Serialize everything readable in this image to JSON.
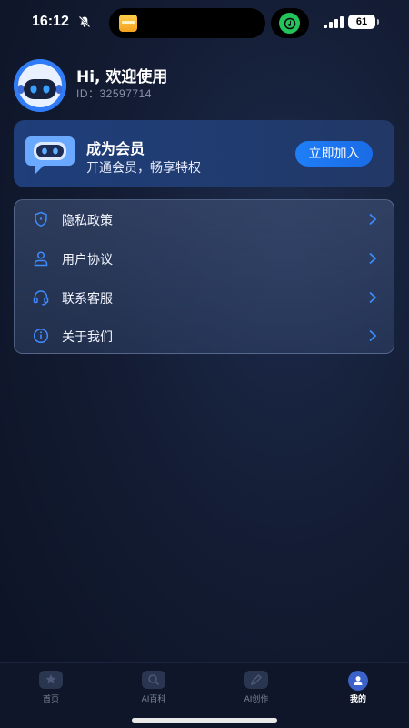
{
  "status_bar": {
    "time": "16:12",
    "battery": "61",
    "icons": [
      "bell-slash-icon",
      "app-activity-icon",
      "music-icon",
      "signal-icon",
      "battery-icon"
    ]
  },
  "profile": {
    "greeting": "Hi, 欢迎使用",
    "id_text": "ID：32597714",
    "avatar_icon": "robot-avatar-icon"
  },
  "member_card": {
    "title": "成为会员",
    "subtitle": "开通会员，畅享特权",
    "button_label": "立即加入",
    "icon": "robot-chat-icon"
  },
  "menu": {
    "items": [
      {
        "label": "隐私政策",
        "icon": "shield-icon"
      },
      {
        "label": "用户协议",
        "icon": "user-icon"
      },
      {
        "label": "联系客服",
        "icon": "headset-icon"
      },
      {
        "label": "关于我们",
        "icon": "info-icon"
      }
    ]
  },
  "tabbar": {
    "tabs": [
      {
        "label": "首页",
        "icon": "home-icon",
        "active": false
      },
      {
        "label": "AI百科",
        "icon": "search-icon",
        "active": false
      },
      {
        "label": "AI创作",
        "icon": "pen-icon",
        "active": false
      },
      {
        "label": "我的",
        "icon": "profile-icon",
        "active": true
      }
    ]
  },
  "colors": {
    "accent": "#1f7ef7",
    "background": "#131c33",
    "card": "#1f3e7a"
  }
}
